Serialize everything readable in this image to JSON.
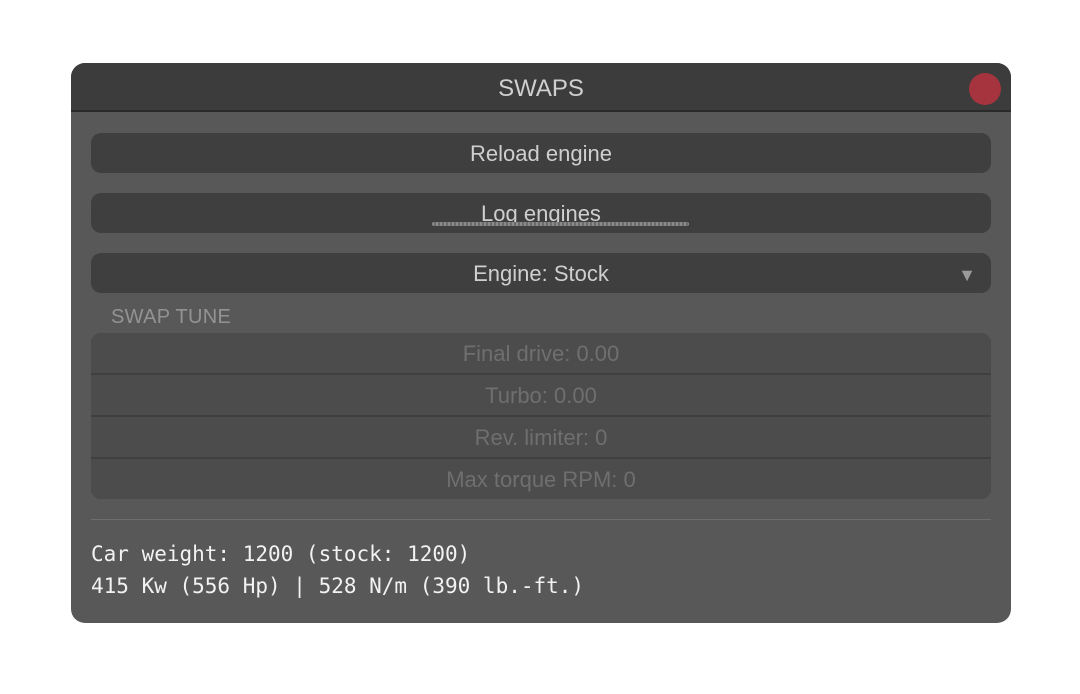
{
  "window": {
    "title": "SWAPS",
    "close_color": "#a6343f"
  },
  "buttons": {
    "reload_label": "Reload engine",
    "log_label": "Log engines"
  },
  "engine_dropdown": {
    "label": "Engine: Stock",
    "arrow_icon": "triangle-down-icon",
    "arrow_glyph": "▼"
  },
  "swap_tune": {
    "section_label": "SWAP TUNE",
    "rows": [
      {
        "label": "Final drive: 0.00"
      },
      {
        "label": "Turbo: 0.00"
      },
      {
        "label": "Rev. limiter: 0"
      },
      {
        "label": "Max torque RPM: 0"
      }
    ]
  },
  "stats": {
    "weight_line": "Car weight: 1200 (stock: 1200)",
    "power_line": "415 Kw (556 Hp) | 528 N/m (390 lb.-ft.)"
  }
}
